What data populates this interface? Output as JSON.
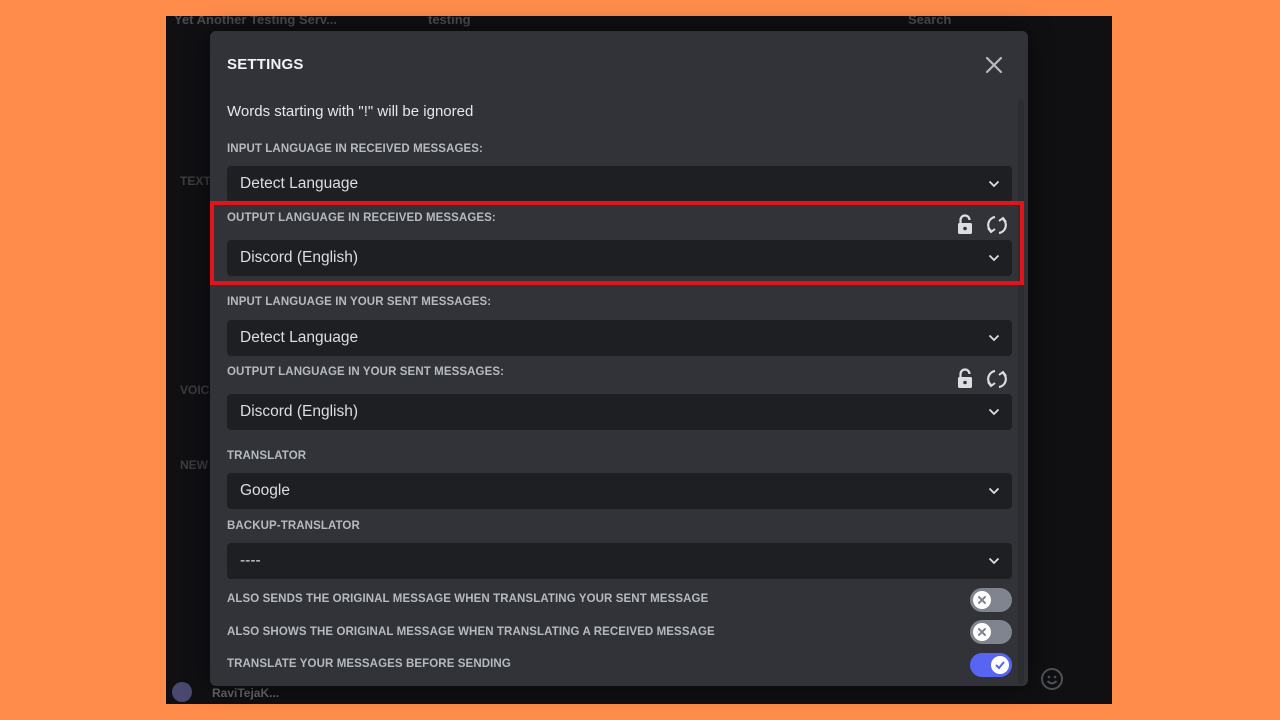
{
  "background": {
    "server_name": "Yet Another Testing Serv...",
    "channel_name": "testing",
    "search_placeholder": "Search",
    "sidebar_sections": [
      "TEXT",
      "VOICE",
      "NEW"
    ],
    "username": "RaviTejaK..."
  },
  "modal": {
    "title": "SETTINGS",
    "note": "Words starting with \"!\" will be ignored",
    "fields": [
      {
        "label": "INPUT LANGUAGE IN RECEIVED MESSAGES:",
        "value": "Detect Language"
      },
      {
        "label": "OUTPUT LANGUAGE IN RECEIVED MESSAGES:",
        "value": "Discord (English)"
      },
      {
        "label": "INPUT LANGUAGE IN YOUR SENT MESSAGES:",
        "value": "Detect Language"
      },
      {
        "label": "OUTPUT LANGUAGE IN YOUR SENT MESSAGES:",
        "value": "Discord (English)"
      },
      {
        "label": "TRANSLATOR",
        "value": "Google"
      },
      {
        "label": "BACKUP-TRANSLATOR",
        "value": "----"
      }
    ],
    "toggles": [
      {
        "label": "ALSO SENDS THE ORIGINAL MESSAGE WHEN TRANSLATING YOUR SENT MESSAGE",
        "state": "off"
      },
      {
        "label": "ALSO SHOWS THE ORIGINAL MESSAGE WHEN TRANSLATING A RECEIVED MESSAGE",
        "state": "off"
      },
      {
        "label": "TRANSLATE YOUR MESSAGES BEFORE SENDING",
        "state": "on"
      }
    ]
  },
  "colors": {
    "page_background": "#FF8C4B",
    "modal_background": "#313338",
    "input_background": "#1e1f22",
    "highlight_border": "#e1141c",
    "toggle_on": "#5865f2",
    "toggle_off": "#80848e"
  },
  "icons": {
    "close": "close-icon",
    "lock": "lock-icon",
    "swap": "swap-icon",
    "chevron": "chevron-down-icon"
  }
}
